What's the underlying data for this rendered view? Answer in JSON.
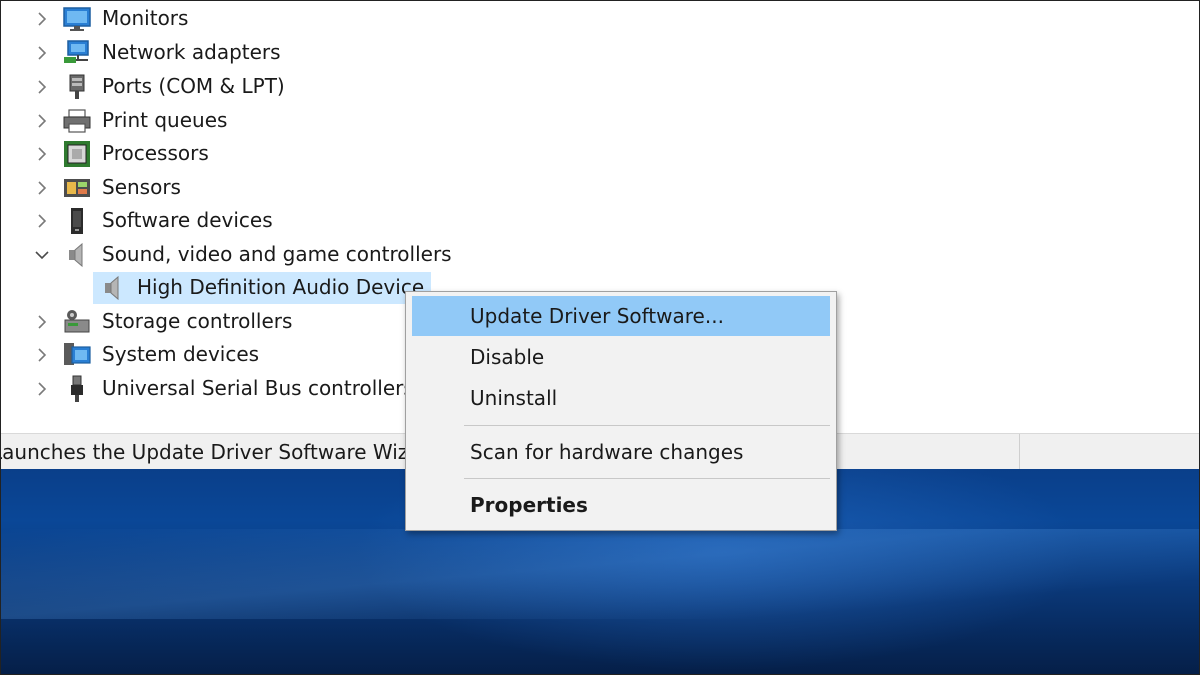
{
  "tree": {
    "items": [
      {
        "label": "Monitors",
        "icon": "monitor-icon",
        "expanded": false
      },
      {
        "label": "Network adapters",
        "icon": "network-adapter-icon",
        "expanded": false
      },
      {
        "label": "Ports (COM & LPT)",
        "icon": "port-icon",
        "expanded": false
      },
      {
        "label": "Print queues",
        "icon": "printer-icon",
        "expanded": false
      },
      {
        "label": "Processors",
        "icon": "processor-icon",
        "expanded": false
      },
      {
        "label": "Sensors",
        "icon": "sensor-icon",
        "expanded": false
      },
      {
        "label": "Software devices",
        "icon": "software-device-icon",
        "expanded": false
      },
      {
        "label": "Sound, video and game controllers",
        "icon": "speaker-icon",
        "expanded": true
      },
      {
        "label": "High Definition Audio Device",
        "icon": "speaker-icon",
        "child": true,
        "selected": true
      },
      {
        "label": "Storage controllers",
        "icon": "storage-controller-icon",
        "expanded": false
      },
      {
        "label": "System devices",
        "icon": "system-device-icon",
        "expanded": false
      },
      {
        "label": "Universal Serial Bus controllers",
        "icon": "usb-icon",
        "expanded": false
      }
    ]
  },
  "status_bar": {
    "text": "Launches the Update Driver Software Wizard for the selected device."
  },
  "context_menu": {
    "items": [
      {
        "label": "Update Driver Software...",
        "highlighted": true
      },
      {
        "label": "Disable"
      },
      {
        "label": "Uninstall"
      },
      {
        "label": "Scan for hardware changes"
      },
      {
        "label": "Properties",
        "bold": true
      }
    ]
  },
  "colors": {
    "selection": "#cce8ff",
    "menu_highlight": "#91c9f7",
    "desktop_blue": "#0a4797"
  }
}
